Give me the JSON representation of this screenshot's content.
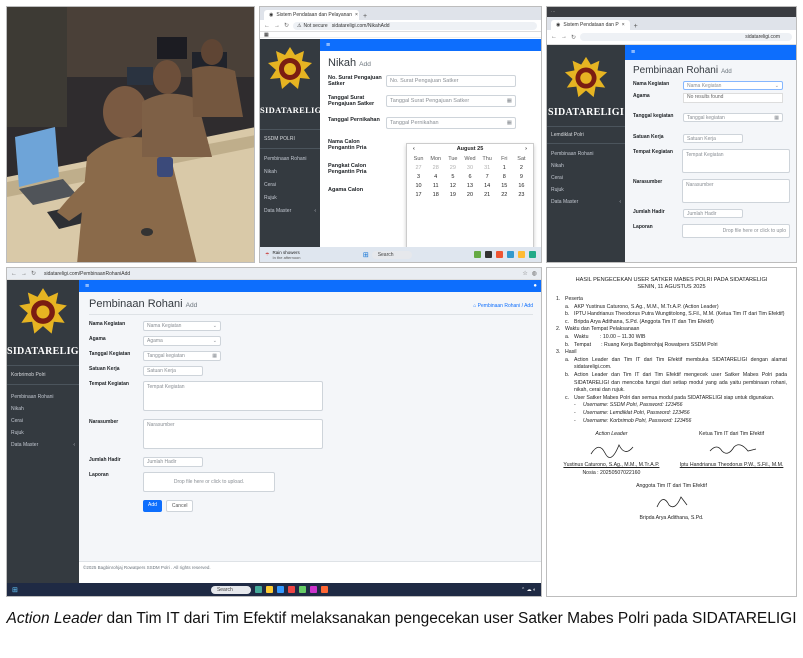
{
  "caption": {
    "emphasis": "Action Leader",
    "text": " dan Tim IT dari Tim Efektif melaksanakan pengecekan user Satker Mabes Polri pada SIDATARELIGI"
  },
  "brand": {
    "name": "SIDATARELIGI",
    "accent": "#0d6efd",
    "sidebar_bg": "#343a40"
  },
  "nikah_panel": {
    "tab_title": "Sistem Pendataan dan Pelayanan",
    "url_warning": "Not secure",
    "url": "sidatareligi.com/NikahAdd",
    "side_user": "SSDM POLRI",
    "menu": [
      "Pembinaan Rohani",
      "Nikah",
      "Cerai",
      "Rujuk",
      "Data Master"
    ],
    "heading": "Nikah",
    "heading_small": "Add",
    "fields": [
      {
        "label": "No. Surat Pengajuan Satker",
        "placeholder": "No. Surat Pengajuan Satker"
      },
      {
        "label": "Tanggal Surat Pengajuan Satker",
        "placeholder": "Tanggal Surat Pengajuan Satker"
      },
      {
        "label": "Tanggal Pernikahan",
        "placeholder": "Tanggal Pernikahan"
      },
      {
        "label": "Nama Calon Pengantin Pria",
        "placeholder": ""
      },
      {
        "label": "Pangkat Calon Pengantin Pria",
        "placeholder": ""
      },
      {
        "label": "Agama Calon",
        "placeholder": ""
      }
    ],
    "calendar": {
      "month": "August",
      "year": "25",
      "days_of_week": [
        "Sun",
        "Mon",
        "Tue",
        "Wed",
        "Thu",
        "Fri",
        "Sat"
      ],
      "rows": [
        [
          "27",
          "28",
          "29",
          "30",
          "31",
          "1",
          "2"
        ],
        [
          "3",
          "4",
          "5",
          "6",
          "7",
          "8",
          "9"
        ],
        [
          "10",
          "11",
          "12",
          "13",
          "14",
          "15",
          "16"
        ],
        [
          "17",
          "18",
          "19",
          "20",
          "21",
          "22",
          "23"
        ]
      ]
    },
    "taskbar": {
      "weather": "Rain showers",
      "weather_sub": "In the afternoon",
      "search": "Search"
    }
  },
  "rohani1_panel": {
    "tab_title": "Sistem Pendataan dan P",
    "url": "sidatareligi.com",
    "side_user": "Lemdiklat Polri",
    "menu": [
      "Pembinaan Rohani",
      "Nikah",
      "Cerai",
      "Rujuk",
      "Data Master"
    ],
    "heading": "Pembinaan Rohani",
    "heading_small": "Add",
    "fields": [
      {
        "label": "Nama Kegiatan",
        "placeholder": "Nama Kegiatan"
      },
      {
        "label": "Agama",
        "placeholder": "No results found"
      },
      {
        "label": "Tanggal kegiatan",
        "placeholder": "Tanggal kegiatan"
      },
      {
        "label": "Satuan Kerja",
        "placeholder": "Satuan Kerja"
      },
      {
        "label": "Tempat Kegiatan",
        "placeholder": "Tempat Kegiatan"
      },
      {
        "label": "Narasumber",
        "placeholder": "Narasumber"
      },
      {
        "label": "Jumlah Hadir",
        "placeholder": "Jumlah Hadir"
      },
      {
        "label": "Laporan",
        "placeholder": "Drop file here or click to uplo"
      }
    ]
  },
  "rohani2_panel": {
    "url": "sidatareligi.com/PembinaanRohaniAdd",
    "side_user": "Korbrimob Polri",
    "menu": [
      "Pembinaan Rohani",
      "Nikah",
      "Cerai",
      "Rujuk",
      "Data Master"
    ],
    "heading": "Pembinaan Rohani",
    "heading_small": "Add",
    "breadcrumb": "Pembinaan Rohani / Add",
    "fields": [
      {
        "label": "Nama Kegiatan",
        "placeholder": "Nama Kegiatan"
      },
      {
        "label": "Agama",
        "placeholder": "Agama"
      },
      {
        "label": "Tanggal Kegiatan",
        "placeholder": "Tanggal kegiatan"
      },
      {
        "label": "Satuan Kerja",
        "placeholder": "Satuan Kerja"
      },
      {
        "label": "Tempat Kegiatan",
        "placeholder": "Tempat Kegiatan"
      },
      {
        "label": "Narasumber",
        "placeholder": "Narasumber"
      },
      {
        "label": "Jumlah Hadir",
        "placeholder": "Jumlah Hadir"
      },
      {
        "label": "Laporan",
        "placeholder": "Drop file here or click to upload."
      }
    ],
    "add_label": "Add",
    "cancel_label": "Cancel",
    "footer": "©2025 Bagbinrohjaj Rowatpers SSDM Polri . All rights reserved.",
    "taskbar_search": "Search"
  },
  "report": {
    "title_1": "HASIL PENGECEKAN USER SATKER MABES POLRI PADA SIDATARELIGI",
    "title_2": "SENIN, 11 AGUSTUS 2025",
    "s1": "Peserta",
    "s1a": "AKP Yustinus Caturono, S.Ag., M.M., M.Tr.A.P. (Action Leader)",
    "s1b": "IPTU Handrianus Theodorus Putra Wungtitolong, S.Fil., M.M. (Ketua Tim IT dari Tim Efektif)",
    "s1c": "Bripda Arya Adithana, S.Pd. (Anggota Tim IT dan Tim Efektif)",
    "s2": "Waktu dan Tempat Pelaksanaan",
    "s2a": "Waktu        : 10.00 – 11.30 WIB",
    "s2b": "Tempat       : Ruang Kerja Bagbinrohjaj Rowatpers SSDM Polri",
    "s3": "Hasil",
    "s3a": "Action Leader dan Tim IT dari Tim Efektif membuka SIDATARELIGI dengan alamat sidatareligi.com.",
    "s3b": "Action Leader dan Tim IT dari Tim Efektif mengecek user Satker Mabes Polri pada SIDATARELIGI dan mencoba fungsi dari setiap modul yang ada yaitu pembinaan rohani, nikah, cerai dan rujuk.",
    "s3c": "User Satker Mabes Polri dan semua modul pada SIDATARELIGI siap untuk digunakan.",
    "u1": "Username: SSDM Polri, Password: 123456",
    "u2": "Username: Lemdiklat Polri, Password: 123456",
    "u3": "Username: Korbrimob Polri, Password: 123456",
    "sig_left_role": "Action Leader",
    "sig_left_name": "Yustinus Caturono, S.Ag., M.M., M.Tr.A.P.",
    "sig_left_nrp": "Nosia : 20250507022160",
    "sig_right_role": "Ketua Tim IT dari Tim Efektif",
    "sig_right_name": "Iptu Handrianus Theodorus P.W., S.Fil., M.M.",
    "sig_bottom_role": "Anggota Tim IT dari Tim Efektif",
    "sig_bottom_name": "Bripda Arya Adithana, S.Pd."
  }
}
